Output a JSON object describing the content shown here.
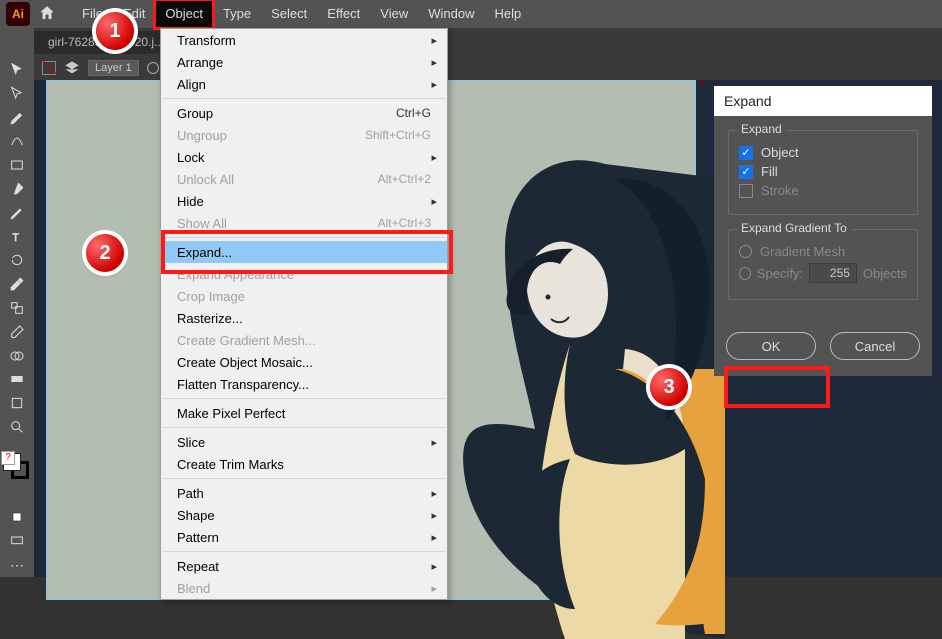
{
  "app": {
    "logo_text": "Ai"
  },
  "menu": {
    "items": [
      "File",
      "Edit",
      "Object",
      "Type",
      "Select",
      "Effect",
      "View",
      "Window",
      "Help"
    ]
  },
  "tab": {
    "name": "girl-7628308_1920.j...",
    "close": "×"
  },
  "layer": {
    "name": "Layer 1"
  },
  "dropdown": {
    "transform": "Transform",
    "arrange": "Arrange",
    "align": "Align",
    "group": "Group",
    "group_sc": "Ctrl+G",
    "ungroup": "Ungroup",
    "ungroup_sc": "Shift+Ctrl+G",
    "lock": "Lock",
    "unlock_all": "Unlock All",
    "unlock_all_sc": "Alt+Ctrl+2",
    "hide": "Hide",
    "show_all": "Show All",
    "show_all_sc": "Alt+Ctrl+3",
    "expand": "Expand...",
    "expand_appearance": "Expand Appearance",
    "crop_image": "Crop Image",
    "rasterize": "Rasterize...",
    "create_gradient_mesh": "Create Gradient Mesh...",
    "create_object_mosaic": "Create Object Mosaic...",
    "flatten_transparency": "Flatten Transparency...",
    "make_pixel_perfect": "Make Pixel Perfect",
    "slice": "Slice",
    "create_trim_marks": "Create Trim Marks",
    "path": "Path",
    "shape": "Shape",
    "pattern": "Pattern",
    "repeat": "Repeat",
    "blend": "Blend"
  },
  "dialog": {
    "title": "Expand",
    "group1_legend": "Expand",
    "object": "Object",
    "fill": "Fill",
    "stroke": "Stroke",
    "group2_legend": "Expand Gradient To",
    "gradient_mesh": "Gradient Mesh",
    "specify": "Specify:",
    "specify_value": "255",
    "specify_suffix": "Objects",
    "ok": "OK",
    "cancel": "Cancel"
  },
  "callouts": {
    "c1": "1",
    "c2": "2",
    "c3": "3"
  }
}
